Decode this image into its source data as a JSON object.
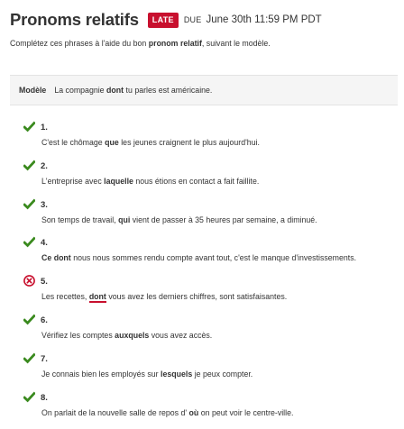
{
  "header": {
    "title": "Pronoms relatifs",
    "late_badge": "LATE",
    "due_label": "DUE",
    "due_date": "June 30th 11:59 PM PDT"
  },
  "instructions": {
    "before": "Complétez ces phrases à l'aide du bon ",
    "bold": "pronom relatif",
    "after": ", suivant le modèle."
  },
  "model": {
    "label": "Modèle",
    "before": "La compagnie ",
    "bold": "dont",
    "after": " tu parles est américaine."
  },
  "colors": {
    "correct": "#3a8a1e",
    "incorrect": "#c8102e"
  },
  "items": [
    {
      "number": "1.",
      "status": "correct",
      "before": "C'est le chômage ",
      "answer": "que",
      "after": " les jeunes craignent le plus aujourd'hui."
    },
    {
      "number": "2.",
      "status": "correct",
      "before": "L'entreprise avec ",
      "answer": "laquelle",
      "after": " nous étions en contact a fait faillite."
    },
    {
      "number": "3.",
      "status": "correct",
      "before": "Son temps de travail, ",
      "answer": "qui",
      "after": " vient de passer à 35 heures par semaine, a diminué."
    },
    {
      "number": "4.",
      "status": "correct",
      "before": "",
      "answer": "Ce dont",
      "after": " nous nous sommes rendu compte avant tout, c'est le manque d'investissements."
    },
    {
      "number": "5.",
      "status": "incorrect",
      "before": "Les recettes, ",
      "answer": "dont",
      "after": " vous avez les derniers chiffres, sont satisfaisantes."
    },
    {
      "number": "6.",
      "status": "correct",
      "before": "Vérifiez les comptes ",
      "answer": "auxquels",
      "after": " vous avez accès."
    },
    {
      "number": "7.",
      "status": "correct",
      "before": "Je connais bien les employés sur ",
      "answer": "lesquels",
      "after": " je peux compter."
    },
    {
      "number": "8.",
      "status": "correct",
      "before": "On parlait de la nouvelle salle de repos d' ",
      "answer": "où",
      "after": " on peut voir le centre-ville."
    }
  ]
}
